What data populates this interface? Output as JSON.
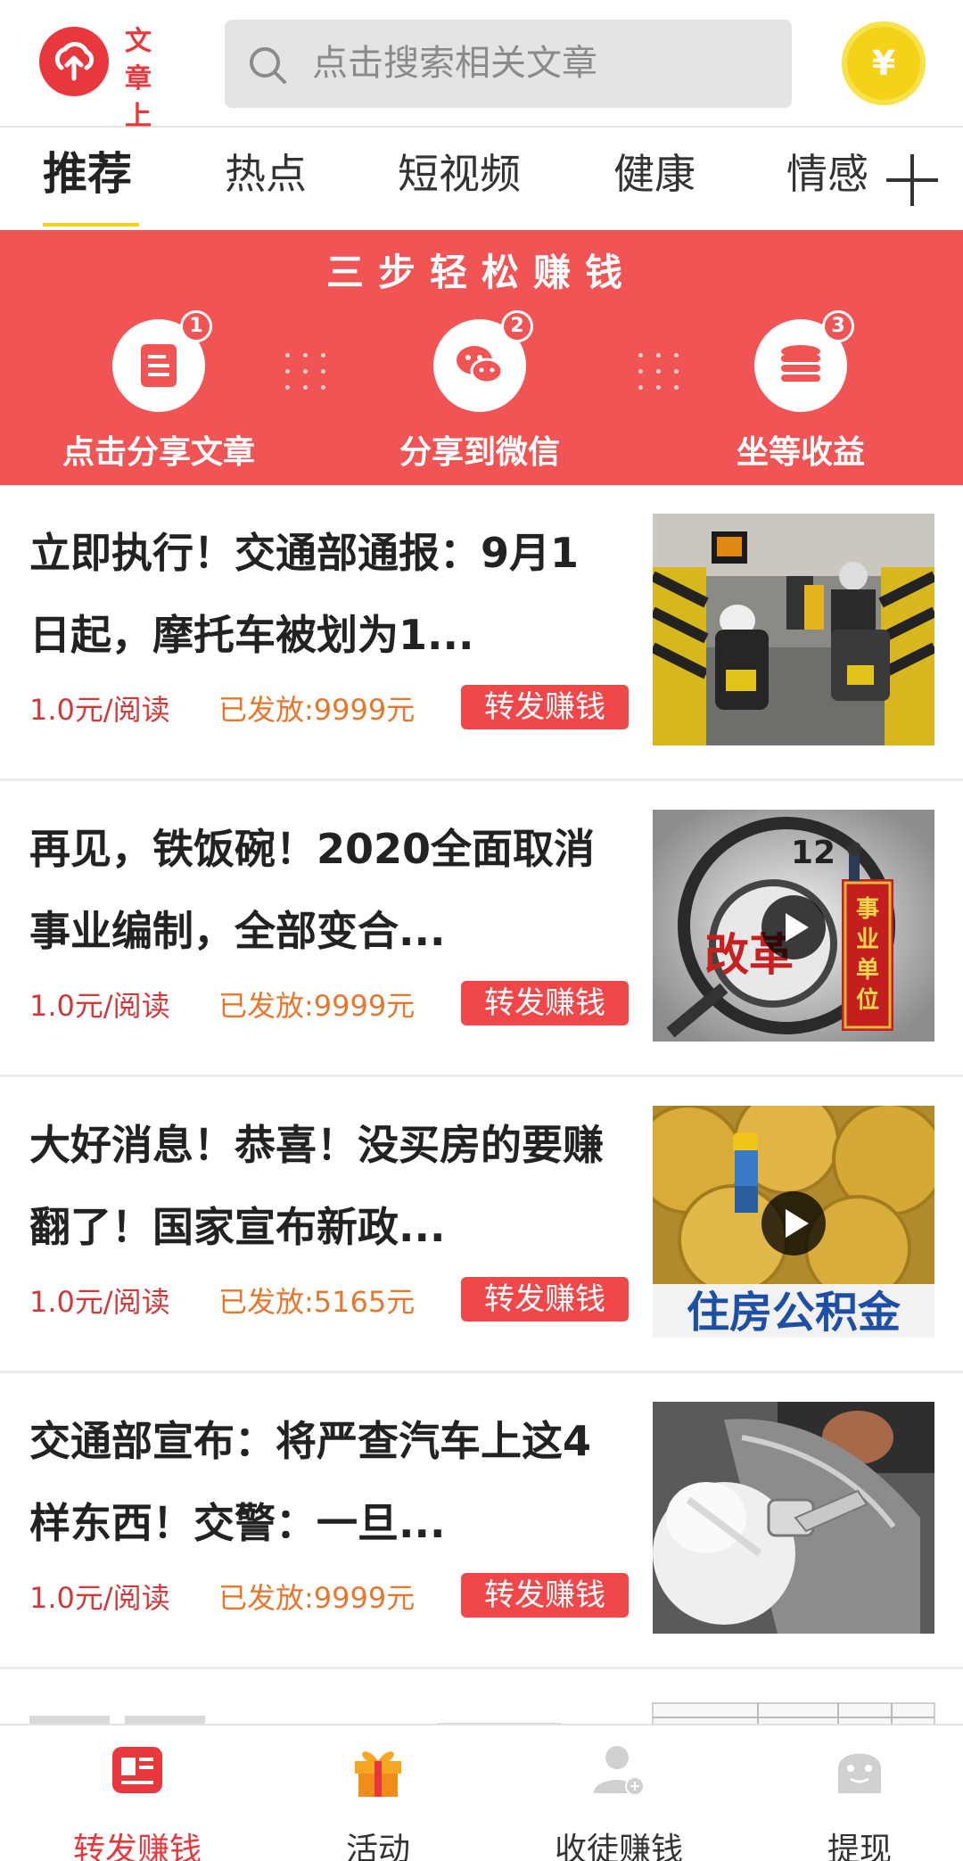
{
  "header": {
    "logo_line1": "文章",
    "logo_line2": "上传",
    "search_placeholder": "点击搜索相关文章",
    "coin_symbol": "¥"
  },
  "tabs": [
    {
      "label": "推荐",
      "active": true
    },
    {
      "label": "热点"
    },
    {
      "label": "短视频"
    },
    {
      "label": "健康"
    },
    {
      "label": "情感"
    }
  ],
  "banner": {
    "title": "三步轻松赚钱",
    "steps": [
      {
        "num": "1",
        "label": "点击分享文章",
        "icon": "document-icon"
      },
      {
        "num": "2",
        "label": "分享到微信",
        "icon": "wechat-icon"
      },
      {
        "num": "3",
        "label": "坐等收益",
        "icon": "coins-icon"
      }
    ]
  },
  "articles": [
    {
      "title": "立即执行！交通部通报：9月1日起，摩托车被划为1...",
      "price": "1.0元/阅读",
      "paid": "已发放:9999元",
      "button": "转发赚钱",
      "thumb": "motorcycles-toll-photo",
      "video": false
    },
    {
      "title": "再见，铁饭碗！2020全面取消事业编制，全部变合...",
      "price": "1.0元/阅读",
      "paid": "已发放:9999元",
      "button": "转发赚钱",
      "thumb": "reform-magnifier-photo",
      "video": true,
      "thumb_text_1": "改革",
      "thumb_text_2": "事业单位"
    },
    {
      "title": "大好消息！恭喜！没买房的要赚翻了！国家宣布新政...",
      "price": "1.0元/阅读",
      "paid": "已发放:5165元",
      "button": "转发赚钱",
      "thumb": "coins-housing-fund-photo",
      "video": true,
      "thumb_text_1": "住房公积金"
    },
    {
      "title": "交通部宣布：将严查汽车上这4样东西！交警：一旦...",
      "price": "1.0元/阅读",
      "paid": "已发放:9999元",
      "button": "转发赚钱",
      "thumb": "car-fuel-cap-photo",
      "video": false
    }
  ],
  "bottom_nav": [
    {
      "label": "转发赚钱",
      "icon": "share-earn-icon",
      "active": true
    },
    {
      "label": "活动",
      "icon": "gift-icon"
    },
    {
      "label": "收徒赚钱",
      "icon": "add-user-icon"
    },
    {
      "label": "提现",
      "icon": "ghost-icon"
    }
  ],
  "colors": {
    "accent": "#e8383d",
    "banner": "#f15455",
    "coin": "#f5d21a",
    "paid": "#e8772e"
  }
}
